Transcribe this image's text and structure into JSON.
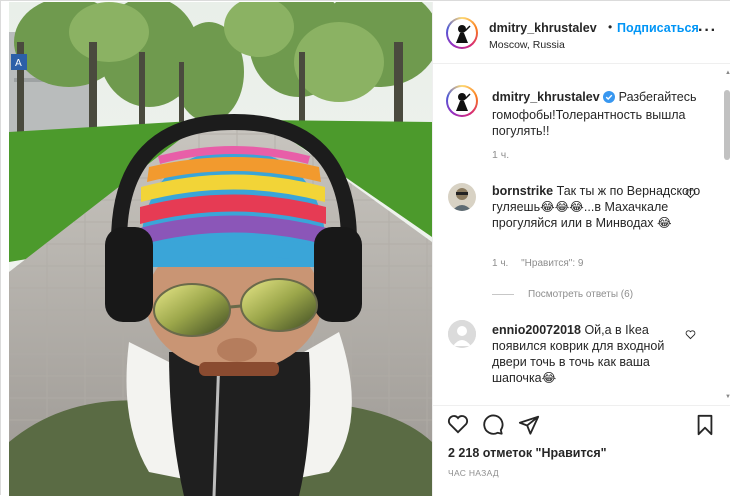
{
  "header": {
    "username": "dmitry_khrustalev",
    "separator": "•",
    "follow_label": "Подписаться",
    "location": "Moscow, Russia",
    "more_icon": "more-horizontal-icon",
    "more_label": "···"
  },
  "caption": {
    "username": "dmitry_khrustalev",
    "verified_icon": "verified-badge-icon",
    "text": "Разбегайтесь гомофобы!Толерантность вышла погулять!!",
    "time": "1 ч."
  },
  "comments": [
    {
      "username": "bornstrike",
      "text": "Так ты ж по Вернадского гуляешь😂😂😂...в Махачкале прогуляйся или в Минводах 😂",
      "time": "1 ч.",
      "likes": "\"Нравится\": 9",
      "view_replies": "Посмотреть ответы (6)"
    },
    {
      "username": "ennio20072018",
      "text": "Ой,а в Ikea появился коврик для входной двери точь в точь как ваша шапочка😂"
    }
  ],
  "footer": {
    "likes": "2 218 отметок \"Нравится\"",
    "posted": "Час назад"
  },
  "colors": {
    "link_blue": "#0095f6",
    "verified_blue": "#3897f0",
    "muted": "#8e8e8e",
    "text": "#262626"
  }
}
